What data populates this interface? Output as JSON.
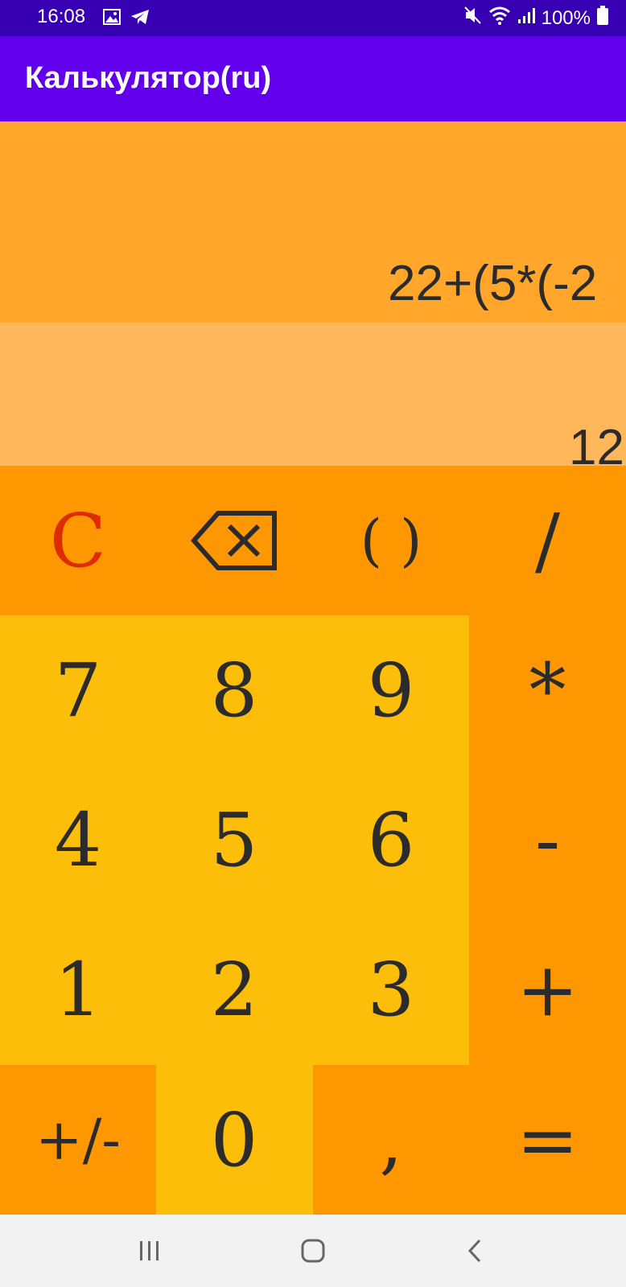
{
  "status_bar": {
    "time": "16:08",
    "battery": "100%",
    "icons": [
      "image-icon",
      "telegram-icon",
      "mute-icon",
      "wifi-icon",
      "signal-icon",
      "battery-icon"
    ]
  },
  "app_bar": {
    "title": "Калькулятор(ru)"
  },
  "display": {
    "expression": "22+(5*(-2",
    "result": "12"
  },
  "keys": {
    "clear": "C",
    "parentheses": "( )",
    "divide": "/",
    "seven": "7",
    "eight": "8",
    "nine": "9",
    "multiply": "*",
    "four": "4",
    "five": "5",
    "six": "6",
    "minus": "-",
    "one": "1",
    "two": "2",
    "three": "3",
    "plus": "+",
    "plus_minus": "+/-",
    "zero": "0",
    "comma": ",",
    "equals": "="
  },
  "colors": {
    "status_bar": "#3700b3",
    "app_bar": "#6200ee",
    "expression_bg": "#ffa62b",
    "result_bg": "#ffb75c",
    "operator_keys": "#ff9800",
    "digit_keys": "#fdbe0a",
    "clear_key": "#dd2c00",
    "text": "#2b2b2b"
  },
  "nav_bar": {
    "icons": [
      "recent-apps-icon",
      "home-icon",
      "back-icon"
    ]
  }
}
